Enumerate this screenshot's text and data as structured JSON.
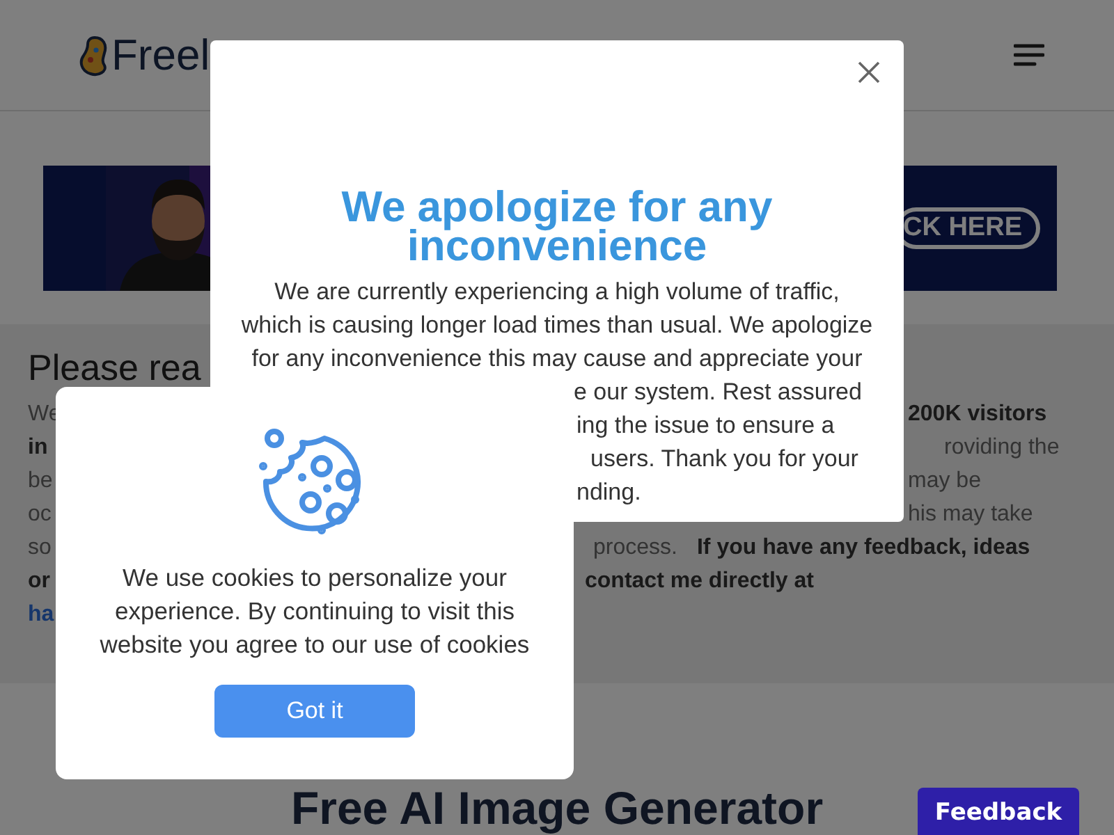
{
  "header": {
    "logo_text": "Freel"
  },
  "banner": {
    "kind": "picture",
    "button": "CK HERE"
  },
  "notice": {
    "heading": "Please rea",
    "lines": [
      {
        "left": {
          "text": "We",
          "bold": false,
          "link": false
        },
        "right": [
          {
            "text": "200K visitors",
            "bold": true
          }
        ]
      },
      {
        "left": {
          "text": "in",
          "bold": true,
          "link": false
        },
        "right": [
          {
            "text": "roviding the",
            "bold": false
          }
        ]
      },
      {
        "left": {
          "text": "be",
          "bold": false,
          "link": false
        },
        "right": [
          {
            "text": "may be",
            "bold": false
          }
        ]
      },
      {
        "left": {
          "text": "oc",
          "bold": false,
          "link": false
        },
        "right": [
          {
            "text": "his may take",
            "bold": false
          }
        ]
      },
      {
        "left": {
          "text": "so",
          "bold": false,
          "link": false
        },
        "right": [
          {
            "text": "process.",
            "bold": false
          },
          {
            "text": "If you have any feedback, ideas",
            "bold": true
          }
        ]
      },
      {
        "left": {
          "text": "or",
          "bold": true,
          "link": false
        },
        "right": [
          {
            "text": "contact me directly at",
            "bold": true
          }
        ]
      },
      {
        "left": {
          "text": "ha",
          "bold": true,
          "link": true
        }
      }
    ]
  },
  "hero_title": "Free AI Image Generator",
  "modal": {
    "title": "We apologize for any inconvenience",
    "lines": [
      {
        "text": "We are currently experiencing a high volume of traffic,",
        "kind": "full"
      },
      {
        "text": "which is causing longer load times than usual. We apologize",
        "kind": "full"
      },
      {
        "text": "for any inconvenience this may cause and appreciate your",
        "kind": "full"
      },
      {
        "text": "e our system. Rest assured",
        "kind": "partial"
      },
      {
        "text": "ing the issue to ensure a",
        "kind": "partial"
      },
      {
        "text": "users. Thank you for your",
        "kind": "partial"
      },
      {
        "text": "nding.",
        "kind": "partial"
      }
    ]
  },
  "cookie": {
    "text": "We use cookies to personalize your experience. By continuing to visit this website you agree to our use of cookies",
    "button": "Got it"
  },
  "feedback": "Feedback"
}
